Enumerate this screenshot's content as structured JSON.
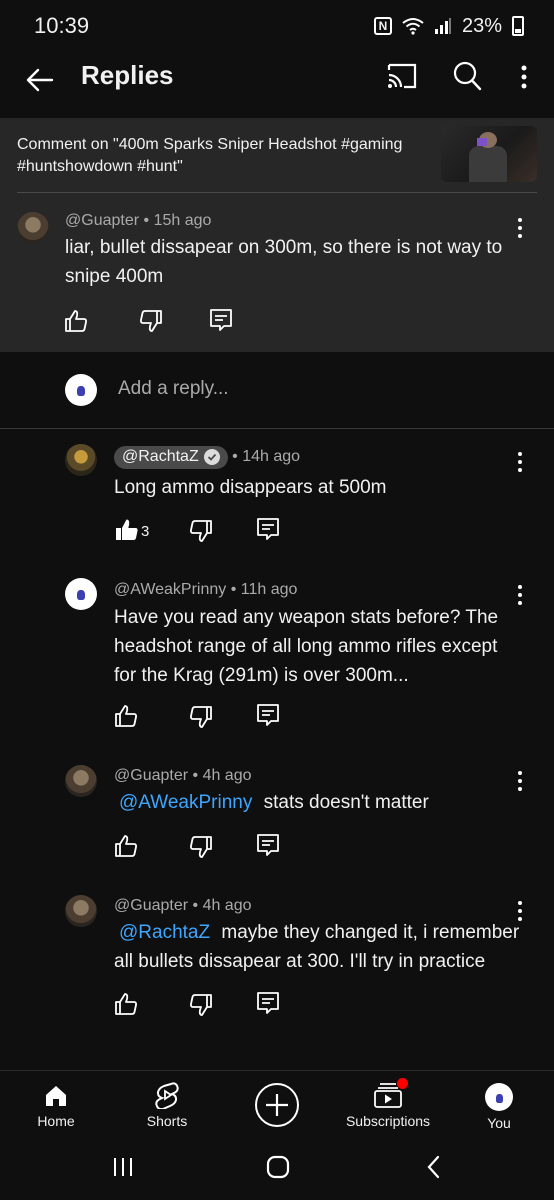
{
  "status": {
    "time": "10:39",
    "battery": "23%"
  },
  "header": {
    "title": "Replies"
  },
  "context": {
    "text": "Comment on \"400m Sparks Sniper Headshot  #gaming #huntshowdown #hunt\""
  },
  "parent_comment": {
    "author": "@Guapter",
    "time": "15h ago",
    "text": "liar, bullet dissapear on 300m, so there is not way to snipe 400m"
  },
  "reply_box": {
    "placeholder": "Add a reply..."
  },
  "replies": [
    {
      "author": "@RachtaZ",
      "verified": true,
      "time": "14h ago",
      "text": "Long ammo disappears at 500m",
      "likes": "3"
    },
    {
      "author": "@AWeakPrinny",
      "time": "11h ago",
      "text": "Have you read any weapon stats before? The headshot range of all long ammo rifles except for the Krag (291m) is over 300m..."
    },
    {
      "author": "@Guapter",
      "time": "4h ago",
      "mention": "@AWeakPrinny",
      "text": "stats doesn't matter"
    },
    {
      "author": "@Guapter",
      "time": "4h ago",
      "mention": "@RachtaZ",
      "text": "maybe they changed it, i remember all bullets dissapear at 300. I'll try in practice"
    }
  ],
  "nav": {
    "home": "Home",
    "shorts": "Shorts",
    "subscriptions": "Subscriptions",
    "you": "You"
  },
  "colors": {
    "background": "#0f0f0f",
    "panel": "#272727",
    "mention": "#3ea6ff",
    "notification": "#ff0000"
  }
}
